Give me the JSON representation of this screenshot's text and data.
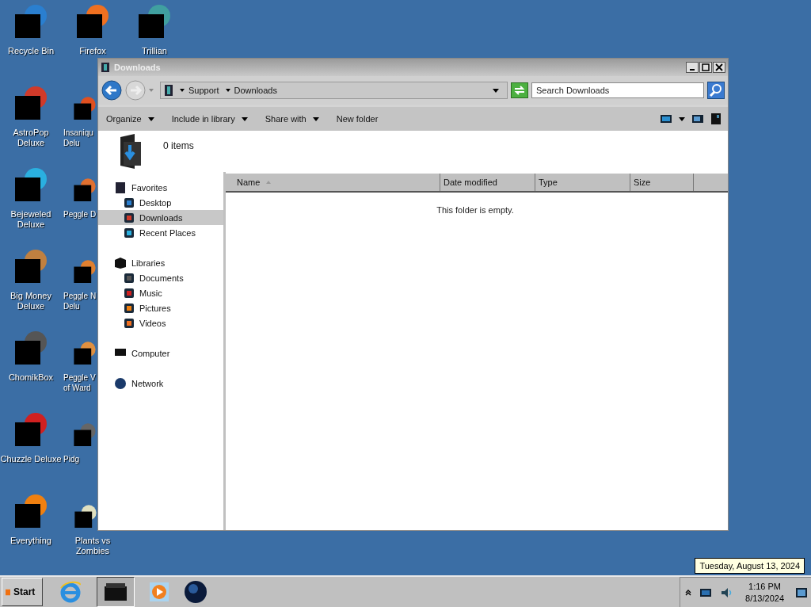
{
  "desktop_icons": [
    {
      "label": "Recycle Bin"
    },
    {
      "label": "AstroPop\nDeluxe"
    },
    {
      "label": "Bejeweled\nDeluxe"
    },
    {
      "label": "Big Money\nDeluxe"
    },
    {
      "label": "ChomikBox"
    },
    {
      "label": "Chuzzle Deluxe"
    },
    {
      "label": "Everything"
    },
    {
      "label": "Firefox"
    },
    {
      "label": "Insaniqu\nDelu"
    },
    {
      "label": "Peggle D"
    },
    {
      "label": "Peggle N\nDelu"
    },
    {
      "label": "Peggle V\nof Ward"
    },
    {
      "label": "Pidg"
    },
    {
      "label": "Plants vs\nZombies"
    },
    {
      "label": "Trillian"
    }
  ],
  "window": {
    "title": "Downloads",
    "breadcrumb": [
      "Support",
      "Downloads"
    ],
    "search": {
      "placeholder": "Search Downloads"
    },
    "toolbar": [
      {
        "label": "Organize",
        "dropdown": true
      },
      {
        "label": "Include in library",
        "dropdown": true
      },
      {
        "label": "Share with",
        "dropdown": true
      },
      {
        "label": "New folder",
        "dropdown": false
      }
    ],
    "item_count": "0 items",
    "nav": [
      {
        "label": "Favorites",
        "selected": false,
        "children": [
          {
            "label": "Desktop",
            "selected": false
          },
          {
            "label": "Downloads",
            "selected": true
          },
          {
            "label": "Recent Places",
            "selected": false
          }
        ]
      },
      {
        "label": "Libraries",
        "selected": false,
        "children": [
          {
            "label": "Documents",
            "selected": false
          },
          {
            "label": "Music",
            "selected": false
          },
          {
            "label": "Pictures",
            "selected": false
          },
          {
            "label": "Videos",
            "selected": false
          }
        ]
      },
      {
        "label": "Computer",
        "selected": false
      },
      {
        "label": "Network",
        "selected": false
      }
    ],
    "columns": [
      {
        "label": "Name",
        "sorted": true
      },
      {
        "label": "Date modified",
        "sorted": false
      },
      {
        "label": "Type",
        "sorted": false
      },
      {
        "label": "Size",
        "sorted": false
      }
    ],
    "empty_message": "This folder is empty."
  },
  "taskbar": {
    "start": "Start",
    "clock_time": "1:16 PM",
    "clock_date": "8/13/2024",
    "tooltip": "Tuesday, August 13, 2024"
  }
}
